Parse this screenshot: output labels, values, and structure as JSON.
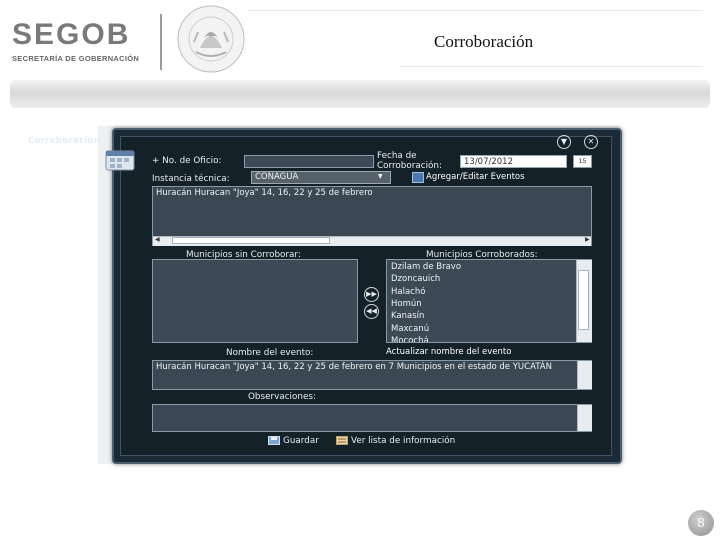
{
  "header": {
    "logo_text": "SEGOB",
    "logo_subtitle": "SECRETARÍA DE GOBERNACIÓN",
    "seal_text": "ESTADOS UNIDOS MEXICANOS",
    "slide_title": "Corroboración"
  },
  "window": {
    "title": "Corroboración",
    "icons": {
      "collapse": "chevron-down-icon",
      "close": "close-icon"
    }
  },
  "form": {
    "oficio_label": "+ No. de Oficio:",
    "oficio_value": "",
    "fecha_label_line1": "Fecha de",
    "fecha_label_line2": "Corroboración:",
    "fecha_value": "13/07/2012",
    "calendar_button": "15",
    "instancia_label": "Instancia técnica:",
    "instancia_value": "CONAGUA",
    "agregar_button": "Agregar/Editar Eventos",
    "eventos_text": "Huracán Huracan \"Joya\" 14, 16, 22 y 25 de febrero",
    "sin_label": "Municipios sin Corroborar:",
    "con_label": "Municipios Corroborados:",
    "municipios_sin": [],
    "municipios_con": [
      "Dzilam de Bravo",
      "Dzoncauich",
      "Halachó",
      "Homún",
      "Kanasín",
      "Maxcanú",
      "Mocochá"
    ],
    "nombre_label": "Nombre del evento:",
    "actualizar_button": "Actualizar nombre del evento",
    "nombre_value": "Huracán Huracan \"Joya\" 14, 16, 22 y 25 de febrero en 7 Municipios en el estado de YUCATÁN",
    "observaciones_label": "Observaciones:",
    "observaciones_value": "",
    "guardar_button": "Guardar",
    "verlista_button": "Ver lista de información"
  },
  "footer": {
    "page_number": "8"
  }
}
